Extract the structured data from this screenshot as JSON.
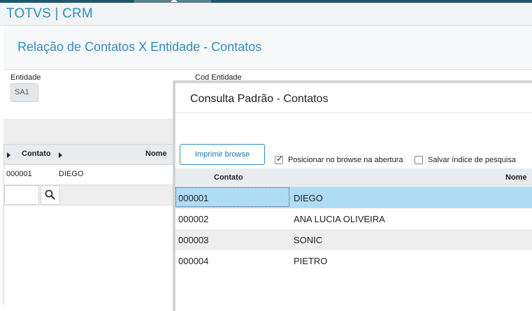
{
  "app": {
    "title": "TOTVS | CRM"
  },
  "page": {
    "title": "Relação de Contatos X Entidade - Contatos"
  },
  "form": {
    "entidade_label": "Entidade",
    "entidade_value": "SA1",
    "cod_entidade_label": "Cod Entidade"
  },
  "left_grid": {
    "columns": [
      "Contato",
      "Nome"
    ],
    "rows": [
      {
        "contato": "000001",
        "nome": "DIEGO"
      }
    ]
  },
  "dialog": {
    "title": "Consulta Padrão - Contatos",
    "print_button": "Imprimir browse",
    "checkbox_position": {
      "label": "Posicionar no browse na abertura",
      "checked": true
    },
    "checkbox_save_index": {
      "label": "Salvar índice de pesquisa",
      "checked": false
    },
    "columns": [
      "Contato",
      "Nome"
    ],
    "rows": [
      {
        "contato": "000001",
        "nome": "DIEGO"
      },
      {
        "contato": "000002",
        "nome": "ANA LUCIA OLIVEIRA"
      },
      {
        "contato": "000003",
        "nome": "SONIC"
      },
      {
        "contato": "000004",
        "nome": "PIETRO"
      }
    ],
    "selected_row_index": 0
  },
  "colors": {
    "accent": "#2d8fc0",
    "topbar": "#1c5869",
    "selected_row": "#aedcf4"
  },
  "icons": {
    "search": "search-icon",
    "caret": "caret-right-icon",
    "check": "checkmark-icon"
  }
}
